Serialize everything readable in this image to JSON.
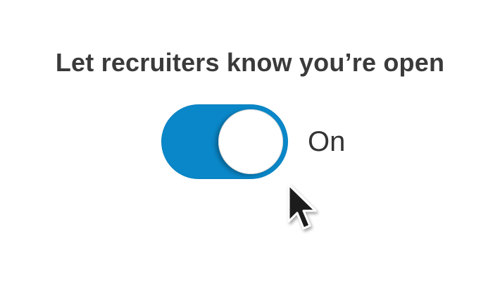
{
  "heading": "Let recruiters know you’re open",
  "toggle": {
    "state_label": "On",
    "checked": true,
    "accent_color": "#0a87c8"
  },
  "icons": {
    "pointer": "mouse-pointer-icon"
  }
}
